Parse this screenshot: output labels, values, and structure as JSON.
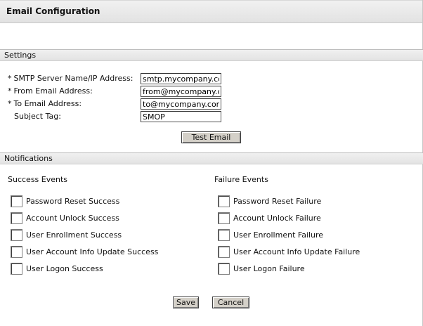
{
  "header": {
    "title": "Email Configuration"
  },
  "settings": {
    "section_title": "Settings",
    "fields": [
      {
        "required_mark": "*",
        "label": "SMTP Server Name/IP Address:",
        "value": "smtp.mycompany.com"
      },
      {
        "required_mark": "*",
        "label": "From Email Address:",
        "value": "from@mycompany.com"
      },
      {
        "required_mark": "*",
        "label": "To Email Address:",
        "value": "to@mycompany.com"
      },
      {
        "required_mark": "",
        "label": "Subject Tag:",
        "value": "SMOP"
      }
    ],
    "test_button_label": "Test Email"
  },
  "notifications": {
    "section_title": "Notifications",
    "success": {
      "heading": "Success Events",
      "items": [
        {
          "label": "Password Reset Success",
          "checked": false
        },
        {
          "label": "Account Unlock Success",
          "checked": false
        },
        {
          "label": "User Enrollment Success",
          "checked": false
        },
        {
          "label": "User Account Info Update Success",
          "checked": false
        },
        {
          "label": "User Logon Success",
          "checked": false
        }
      ]
    },
    "failure": {
      "heading": "Failure Events",
      "items": [
        {
          "label": "Password Reset Failure",
          "checked": false
        },
        {
          "label": "Account Unlock Failure",
          "checked": false
        },
        {
          "label": "User Enrollment Failure",
          "checked": false
        },
        {
          "label": "User Account Info Update Failure",
          "checked": false
        },
        {
          "label": "User Logon Failure",
          "checked": false
        }
      ]
    }
  },
  "footer": {
    "save_label": "Save",
    "cancel_label": "Cancel"
  }
}
